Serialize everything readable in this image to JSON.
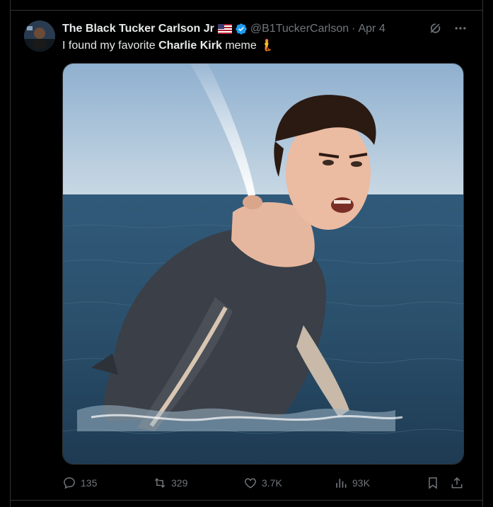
{
  "tweet": {
    "author_name": "The Black Tucker Carlson Jr",
    "handle": "@B1TuckerCarlson",
    "separator": "·",
    "date": "Apr 4",
    "text_prefix": "I found my favorite ",
    "text_bold": "Charlie Kirk",
    "text_suffix": " meme ",
    "text_emoji": "🧜",
    "image_alt": "AI-generated image of a whale with a man's head surfacing from the ocean, spouting water"
  },
  "stats": {
    "replies": "135",
    "reposts": "329",
    "likes": "3.7K",
    "views": "93K"
  },
  "icons": {
    "flag": "us-flag-icon",
    "verified": "verified-badge-icon",
    "grok": "grok-icon",
    "more": "more-icon",
    "reply": "reply-icon",
    "repost": "repost-icon",
    "like": "heart-icon",
    "views": "views-chart-icon",
    "bookmark": "bookmark-icon",
    "share": "share-icon"
  },
  "colors": {
    "background": "#000000",
    "text": "#e7e9ea",
    "muted": "#71767b",
    "verified": "#1d9bf0",
    "border": "#2f3336"
  }
}
